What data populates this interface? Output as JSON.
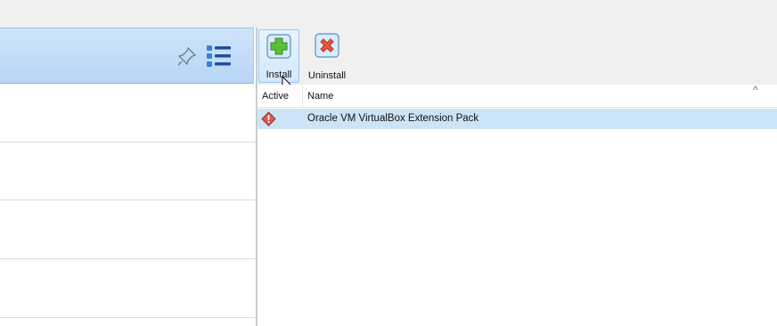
{
  "toolbar": {
    "install_label": "Install",
    "uninstall_label": "Uninstall"
  },
  "table": {
    "columns": [
      "Active",
      "Name"
    ],
    "sort_indicator": "^",
    "rows": [
      {
        "active_icon": "warning-icon",
        "name": "Oracle VM VirtualBox Extension Pack"
      }
    ]
  },
  "icons": {
    "left_header": [
      "pin-icon",
      "list-view-icon"
    ],
    "install": "install-plus-icon",
    "uninstall": "uninstall-x-icon"
  },
  "colors": {
    "selected_row": "#cce4f7",
    "header_blue": "#b7d5f6",
    "install_green": "#5bbf3a",
    "uninstall_red": "#e8553c"
  }
}
